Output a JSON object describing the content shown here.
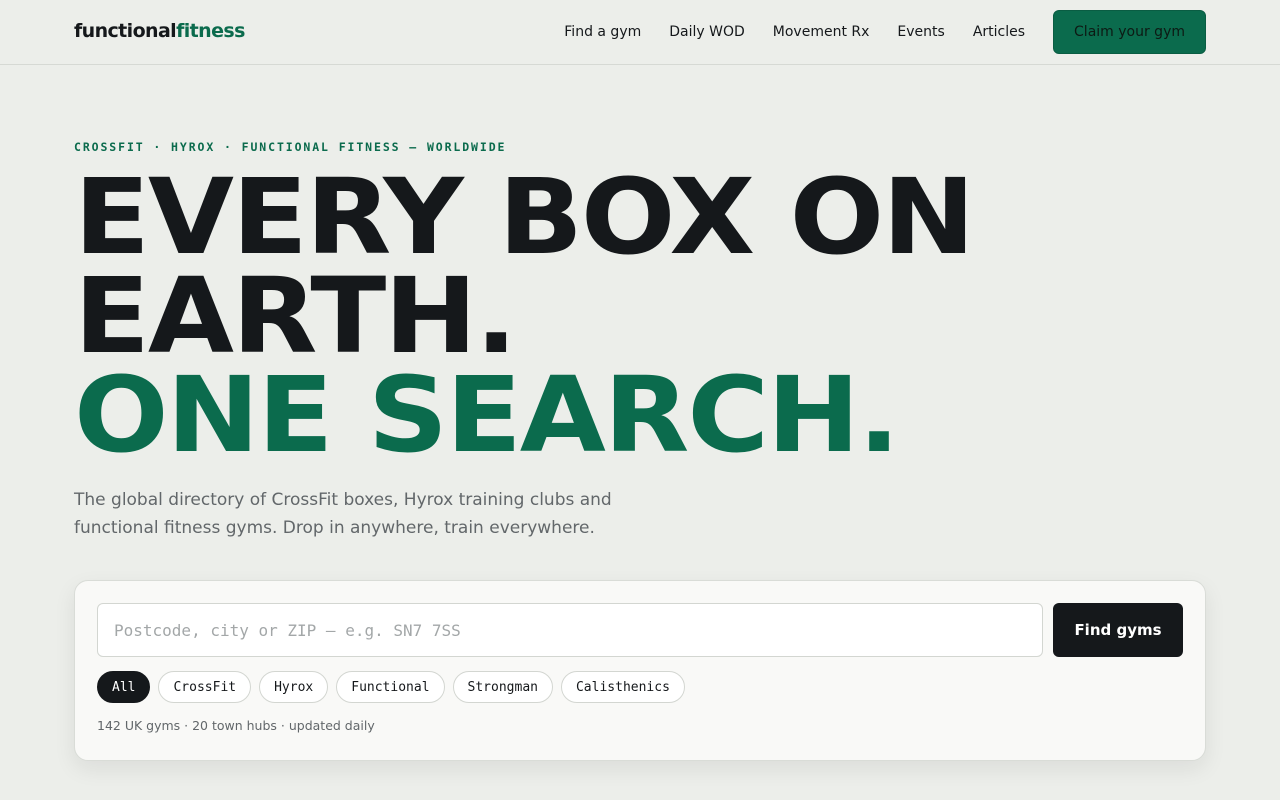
{
  "brand": {
    "name_part1": "functional",
    "name_part2": "fitness",
    "accent_color": "#0b6b4d"
  },
  "nav": {
    "links": [
      {
        "label": "Find a gym"
      },
      {
        "label": "Daily WOD"
      },
      {
        "label": "Movement Rx"
      },
      {
        "label": "Events"
      },
      {
        "label": "Articles"
      }
    ],
    "cta_label": "Claim your gym"
  },
  "hero": {
    "eyebrow": "CROSSFIT · HYROX · FUNCTIONAL FITNESS — WORLDWIDE",
    "headline_line1": "EVERY BOX ON",
    "headline_line2": "EARTH.",
    "headline_line3": "ONE SEARCH.",
    "subtitle": "The global directory of CrossFit boxes, Hyrox training clubs and functional fitness gyms. Drop in anywhere, train everywhere."
  },
  "search": {
    "value": "",
    "placeholder": "Postcode, city or ZIP — e.g. SN7 7SS",
    "button_label": "Find gyms",
    "filters": [
      {
        "label": "All",
        "active": true
      },
      {
        "label": "CrossFit",
        "active": false
      },
      {
        "label": "Hyrox",
        "active": false
      },
      {
        "label": "Functional",
        "active": false
      },
      {
        "label": "Strongman",
        "active": false
      },
      {
        "label": "Calisthenics",
        "active": false
      }
    ],
    "meta": "142 UK gyms · 20 town hubs · updated daily"
  },
  "colors": {
    "background": "#eceeea",
    "ink": "#15181b",
    "muted": "#62676a",
    "card": "#f9f9f7"
  }
}
